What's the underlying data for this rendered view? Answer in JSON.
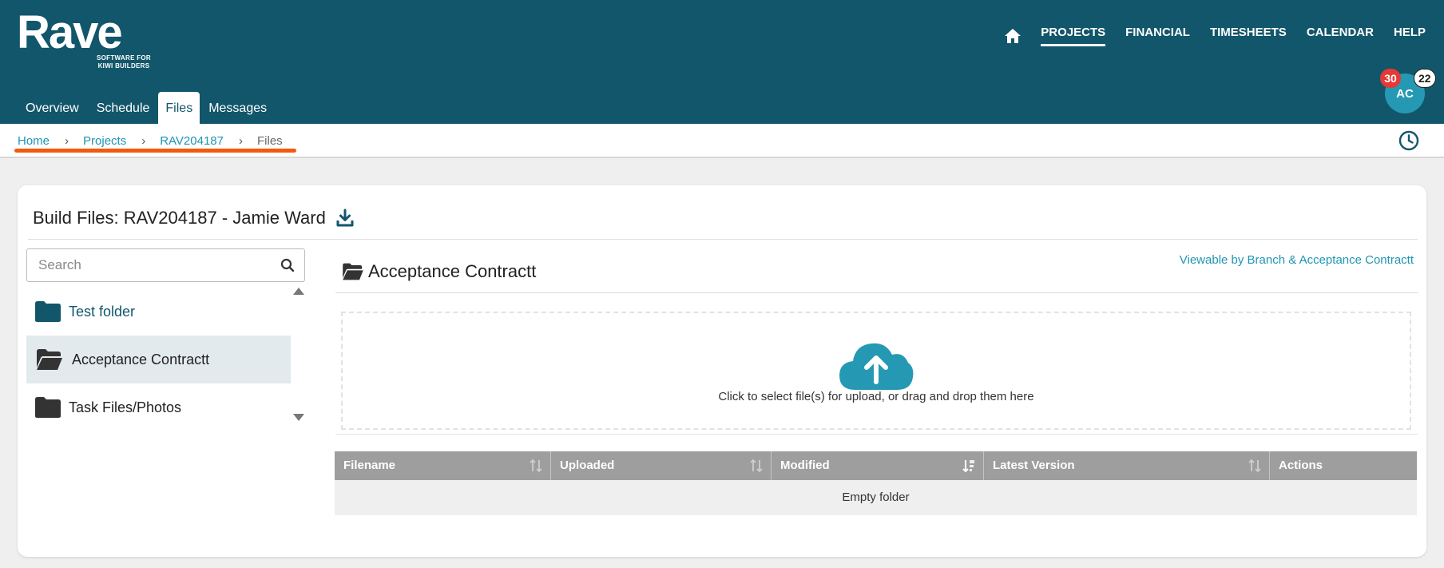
{
  "brand": {
    "name": "Rave",
    "tagline_line1": "SOFTWARE FOR",
    "tagline_line2": "KIWI BUILDERS"
  },
  "top_nav": {
    "items": [
      {
        "label": "PROJECTS",
        "active": true
      },
      {
        "label": "FINANCIAL",
        "active": false
      },
      {
        "label": "TIMESHEETS",
        "active": false
      },
      {
        "label": "CALENDAR",
        "active": false
      },
      {
        "label": "HELP",
        "active": false
      }
    ]
  },
  "tabs": [
    {
      "label": "Overview",
      "active": false
    },
    {
      "label": "Schedule",
      "active": false
    },
    {
      "label": "Files",
      "active": true
    },
    {
      "label": "Messages",
      "active": false
    }
  ],
  "user": {
    "initials": "AC",
    "badge_red": "30",
    "badge_white": "22"
  },
  "breadcrumb": {
    "home": "Home",
    "projects": "Projects",
    "project": "RAV204187",
    "current": "Files",
    "separator": "›"
  },
  "page": {
    "title": "Build Files: RAV204187 - Jamie Ward"
  },
  "sidebar": {
    "search_placeholder": "Search",
    "folders": [
      {
        "name": "Test folder",
        "selected": false
      },
      {
        "name": "Acceptance Contractt",
        "selected": true
      },
      {
        "name": "Task Files/Photos",
        "selected": false
      }
    ]
  },
  "folder_view": {
    "heading": "Acceptance Contractt",
    "viewable_text": "Viewable by Branch & Acceptance Contractt",
    "dropzone_text": "Click to select file(s) for upload, or drag and drop them here"
  },
  "table": {
    "columns": [
      "Filename",
      "Uploaded",
      "Modified",
      "Latest Version",
      "Actions"
    ],
    "empty_text": "Empty folder"
  },
  "colors": {
    "header_bg": "#12566b",
    "accent": "#1e95b3",
    "highlight_underline": "#f25a0d",
    "badge_red": "#e53935",
    "table_header": "#9e9e9e"
  }
}
